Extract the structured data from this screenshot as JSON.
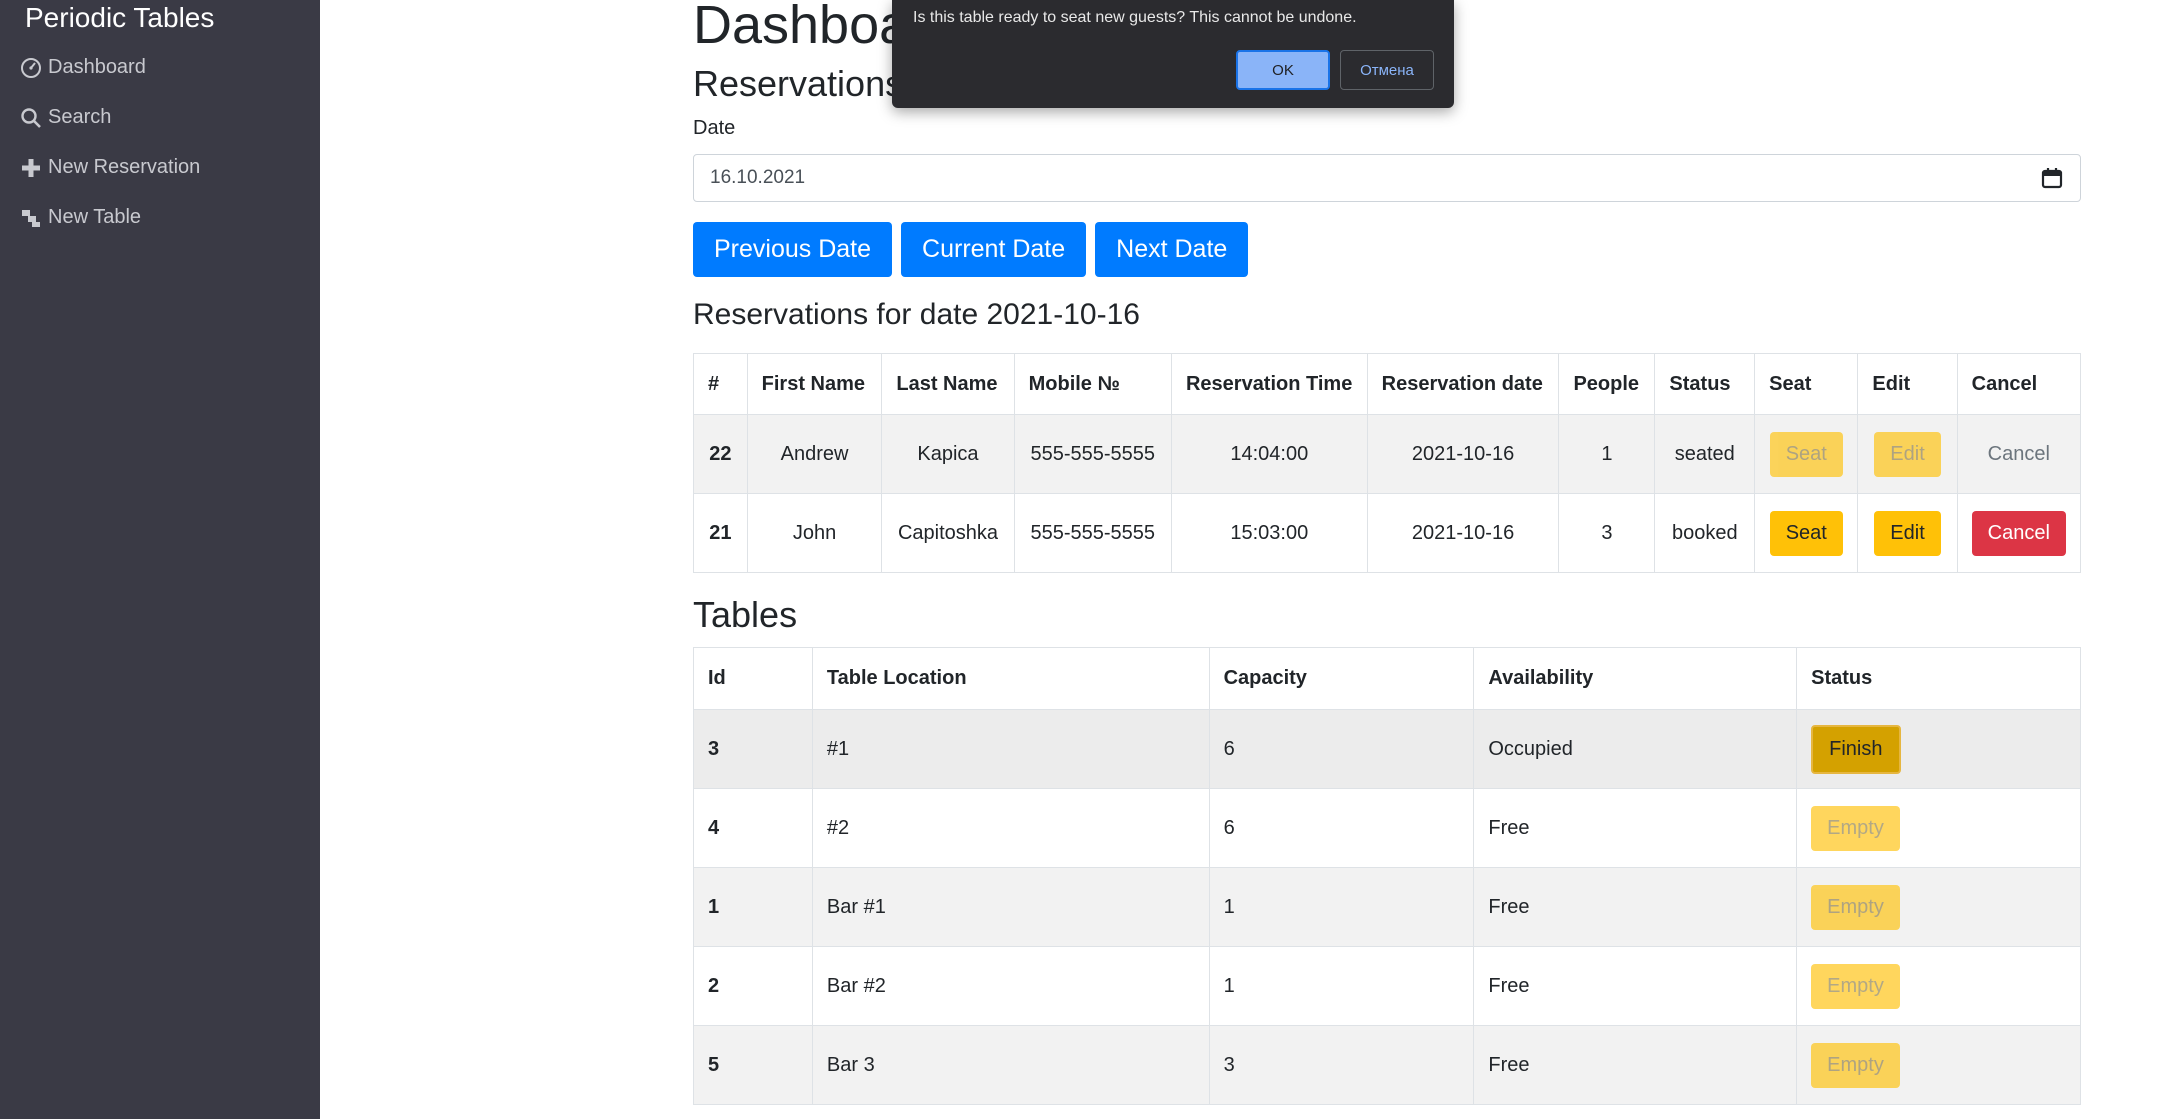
{
  "sidebar": {
    "brand": "Periodic Tables",
    "items": [
      {
        "label": "Dashboard",
        "icon": "dashboard-icon"
      },
      {
        "label": "Search",
        "icon": "search-icon"
      },
      {
        "label": "New Reservation",
        "icon": "plus-icon"
      },
      {
        "label": "New Table",
        "icon": "table-icon"
      }
    ]
  },
  "main": {
    "title": "Dashboard",
    "subtitle": "Reservations",
    "date_label": "Date",
    "date_value": "16.10.2021",
    "buttons": {
      "previous": "Previous Date",
      "current": "Current Date",
      "next": "Next Date"
    },
    "reservations_heading": "Reservations for date 2021-10-16",
    "reservations": {
      "headers": [
        "#",
        "First Name",
        "Last Name",
        "Mobile №",
        "Reservation Time",
        "Reservation date",
        "People",
        "Status",
        "Seat",
        "Edit",
        "Cancel"
      ],
      "rows": [
        {
          "id": "22",
          "first": "Andrew",
          "last": "Kapica",
          "mobile": "555-555-5555",
          "time": "14:04:00",
          "date": "2021-10-16",
          "people": "1",
          "status": "seated",
          "seat": "Seat",
          "edit": "Edit",
          "cancel": "Cancel"
        },
        {
          "id": "21",
          "first": "John",
          "last": "Capitoshka",
          "mobile": "555-555-5555",
          "time": "15:03:00",
          "date": "2021-10-16",
          "people": "3",
          "status": "booked",
          "seat": "Seat",
          "edit": "Edit",
          "cancel": "Cancel"
        }
      ]
    },
    "tables_heading": "Tables",
    "tables": {
      "headers": [
        "Id",
        "Table Location",
        "Capacity",
        "Availability",
        "Status"
      ],
      "rows": [
        {
          "id": "3",
          "location": "#1",
          "capacity": "6",
          "availability": "Occupied",
          "status": "Finish"
        },
        {
          "id": "4",
          "location": "#2",
          "capacity": "6",
          "availability": "Free",
          "status": "Empty"
        },
        {
          "id": "1",
          "location": "Bar #1",
          "capacity": "1",
          "availability": "Free",
          "status": "Empty"
        },
        {
          "id": "2",
          "location": "Bar #2",
          "capacity": "1",
          "availability": "Free",
          "status": "Empty"
        },
        {
          "id": "5",
          "location": "Bar 3",
          "capacity": "3",
          "availability": "Free",
          "status": "Empty"
        }
      ]
    }
  },
  "dialog": {
    "message": "Is this table ready to seat new guests? This cannot be undone.",
    "ok": "OK",
    "cancel": "Отмена"
  },
  "colors": {
    "sidebar_bg": "#3a3a45",
    "primary": "#007bff",
    "warning": "#ffc107",
    "danger": "#dc3545"
  }
}
